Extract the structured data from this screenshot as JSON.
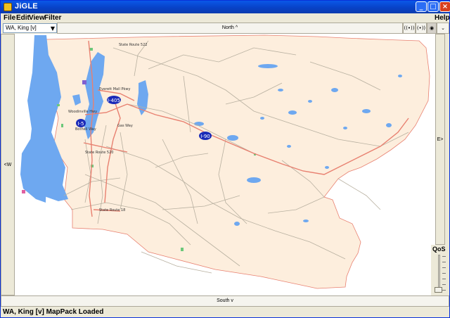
{
  "app": {
    "title": "JiGLE"
  },
  "window_buttons": {
    "minimize": "_",
    "maximize": "□",
    "close": "×"
  },
  "menu": {
    "file": "File",
    "edit": "Edit",
    "view": "View",
    "filter": "Filter",
    "help": "Help"
  },
  "toolbar": {
    "county": "WA, King [v]",
    "north": "North ^",
    "tool1": "((•))",
    "tool2": "(•))",
    "tool3": "◉",
    "tool4": "⌄"
  },
  "nav": {
    "west": "<W",
    "east": "E>",
    "south": "South v"
  },
  "qos": {
    "label": "QoS",
    "level": 0
  },
  "map": {
    "colors": {
      "land": "#fdeedd",
      "water": "#6ea8f0",
      "road": "#b8b0a0",
      "highway": "#e88070",
      "shield": "#1a2ab8",
      "park": "#6cc87a"
    },
    "highways": [
      "I-405",
      "I-5",
      "I-90"
    ],
    "labels": [
      "State Route 522",
      "Everett Mall Pkwy",
      "Bothell Way",
      "State Route 520",
      "Woodinville Hwy",
      "Gas Way",
      "State Route 18"
    ]
  },
  "status": {
    "text": "WA, King [v] MapPack Loaded"
  }
}
